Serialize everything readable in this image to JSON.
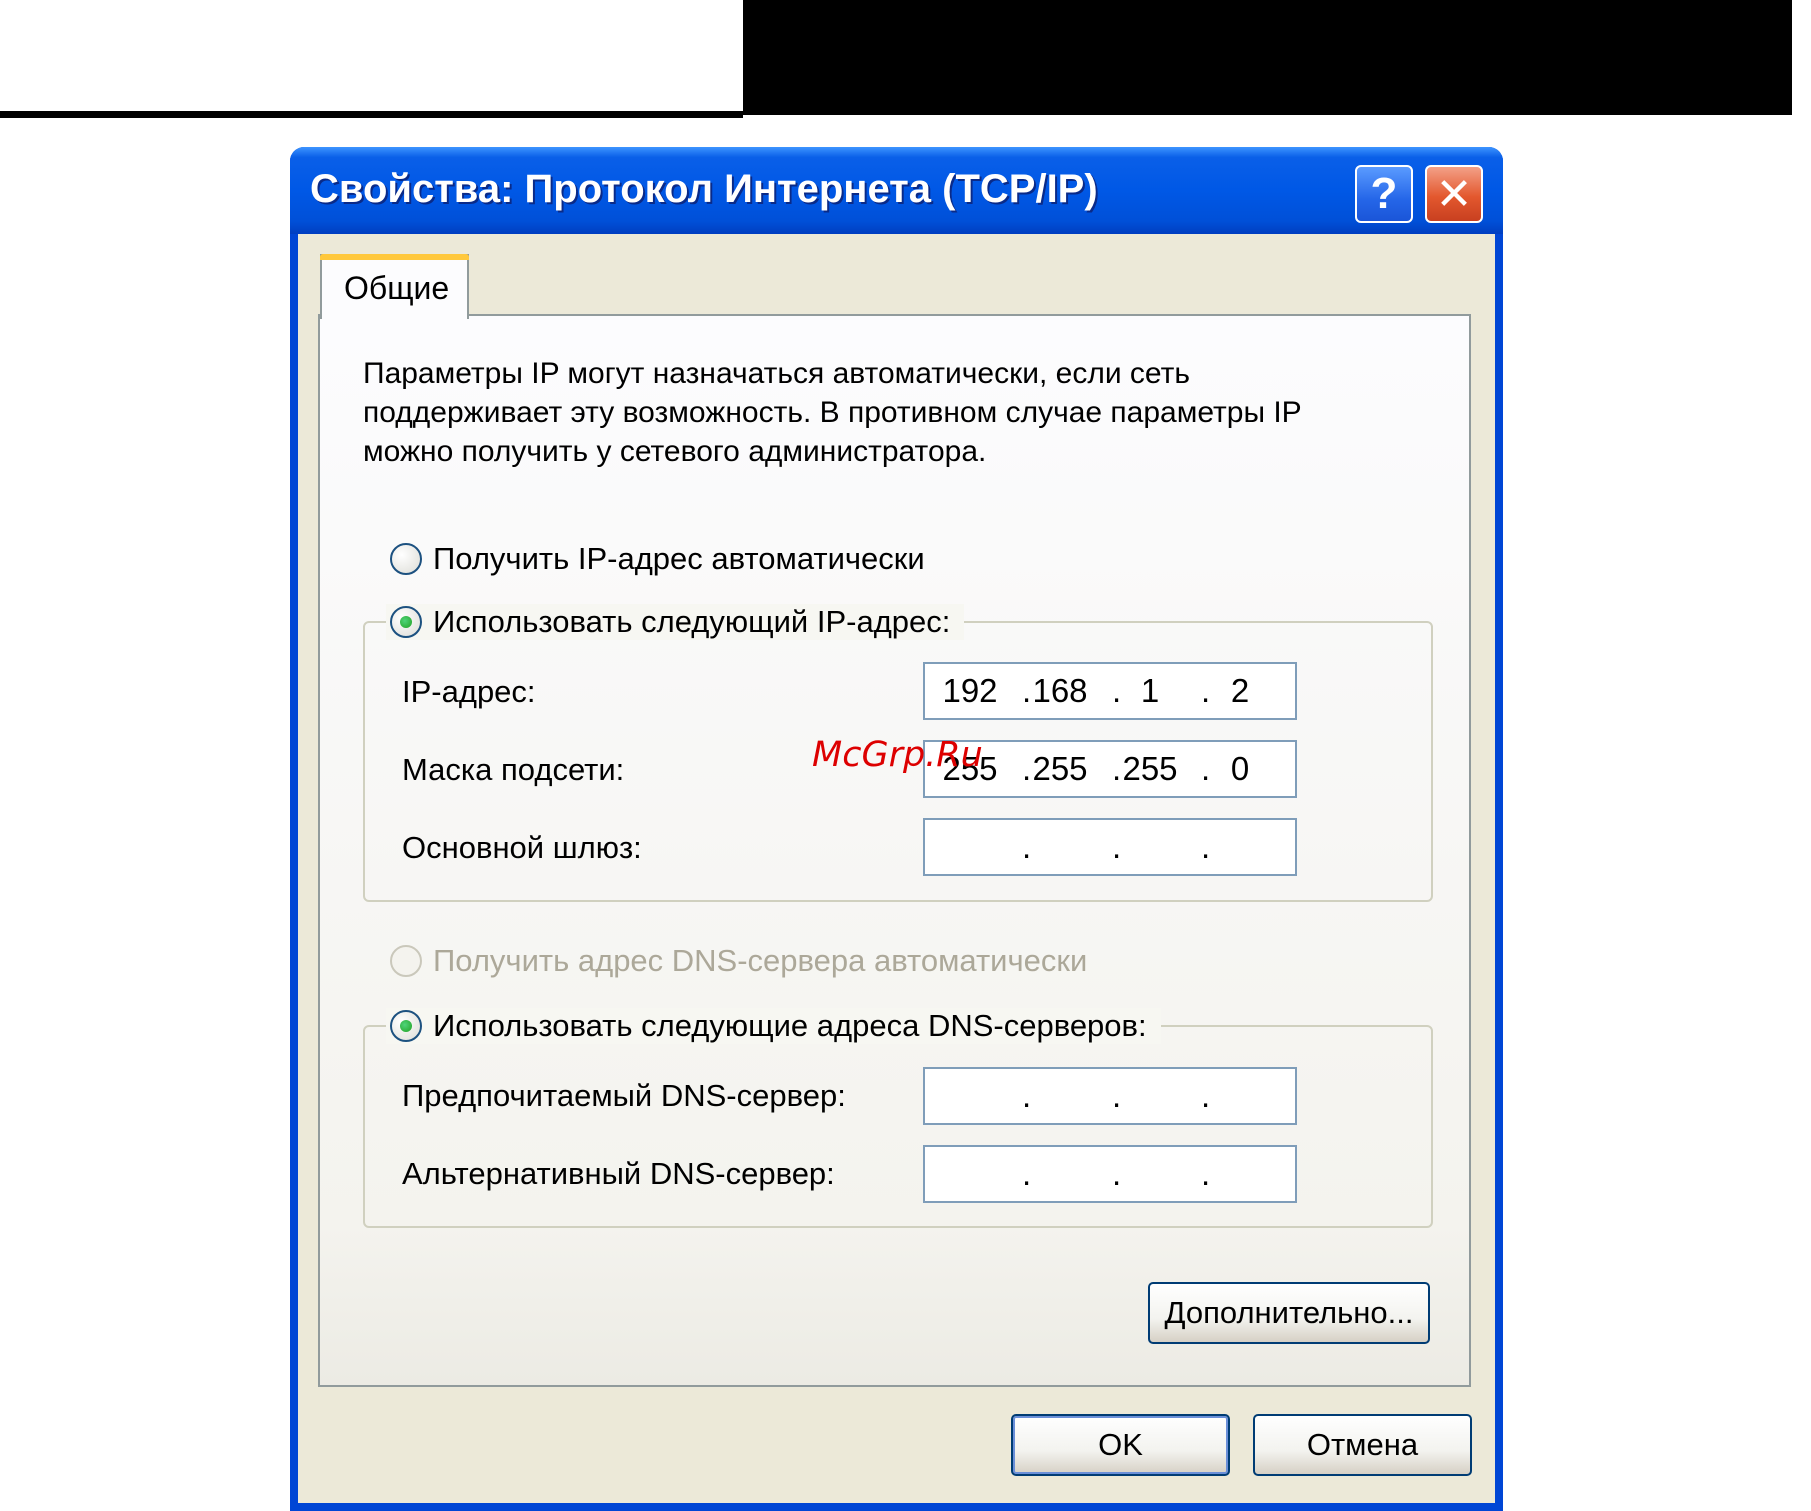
{
  "window": {
    "title": "Свойства: Протокол Интернета (TCP/IP)",
    "help_label": "?",
    "close_label": "✕"
  },
  "tabs": [
    {
      "label": "Общие",
      "selected": true
    }
  ],
  "description": "Параметры IP могут назначаться автоматически, если сеть поддерживает эту возможность. В противном случае параметры IP можно получить у сетевого администратора.",
  "ip_section": {
    "auto_option": {
      "label": "Получить IP-адрес автоматически",
      "checked": false
    },
    "manual_option": {
      "label": "Использовать следующий IP-адрес:",
      "checked": true
    },
    "fields": [
      {
        "label": "IP-адрес:",
        "value": [
          "192",
          "168",
          "1",
          "2"
        ]
      },
      {
        "label": "Маска подсети:",
        "value": [
          "255",
          "255",
          "255",
          "0"
        ]
      },
      {
        "label": "Основной шлюз:",
        "value": [
          "",
          "",
          "",
          ""
        ]
      }
    ]
  },
  "dns_section": {
    "auto_option": {
      "label": "Получить адрес DNS-сервера автоматически",
      "checked": false,
      "disabled": true
    },
    "manual_option": {
      "label": "Использовать следующие адреса DNS-серверов:",
      "checked": true
    },
    "fields": [
      {
        "label": "Предпочитаемый DNS-сервер:",
        "value": [
          "",
          "",
          "",
          ""
        ]
      },
      {
        "label": "Альтернативный DNS-сервер:",
        "value": [
          "",
          "",
          "",
          ""
        ]
      }
    ]
  },
  "buttons": {
    "advanced": "Дополнительно...",
    "ok": "OK",
    "cancel": "Отмена"
  },
  "watermark": "McGrp.Ru",
  "colors": {
    "titlebar": "#0058e6",
    "face": "#ece9d8",
    "radio_checked": "#21a121",
    "tab_highlight": "#ffc83c",
    "watermark": "#dd0000"
  }
}
